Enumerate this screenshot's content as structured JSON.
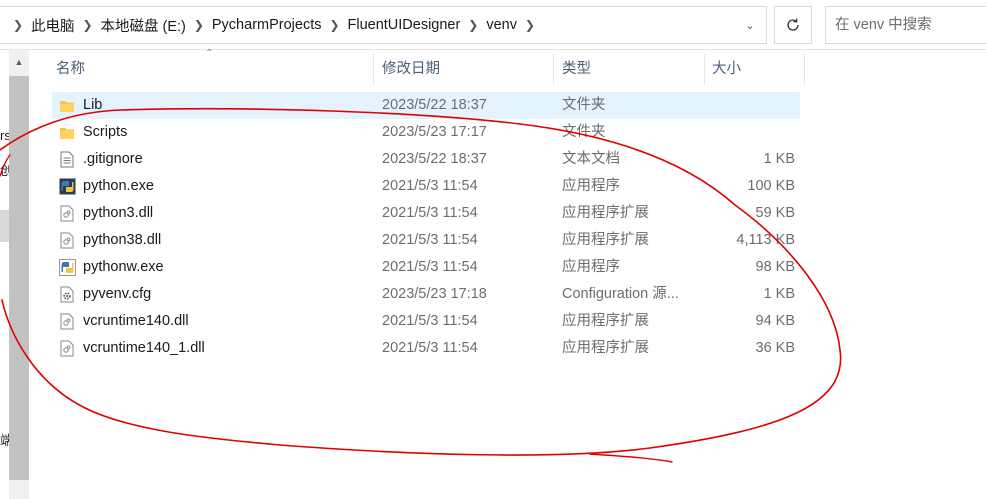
{
  "address_bar": {
    "breadcrumbs": [
      "此电脑",
      "本地磁盘 (E:)",
      "PycharmProjects",
      "FluentUIDesigner",
      "venv"
    ]
  },
  "search": {
    "placeholder": "在 venv 中搜索"
  },
  "nav_fragments": [
    "rs",
    "创",
    "端"
  ],
  "columns": {
    "name": "名称",
    "date": "修改日期",
    "type": "类型",
    "size": "大小"
  },
  "files": [
    {
      "name": "Lib",
      "date": "2023/5/22 18:37",
      "type": "文件夹",
      "size": "",
      "icon": "folder-icon",
      "selected": true
    },
    {
      "name": "Scripts",
      "date": "2023/5/23 17:17",
      "type": "文件夹",
      "size": "",
      "icon": "folder-icon"
    },
    {
      "name": ".gitignore",
      "date": "2023/5/22 18:37",
      "type": "文本文档",
      "size": "1 KB",
      "icon": "text-file-icon"
    },
    {
      "name": "python.exe",
      "date": "2021/5/3 11:54",
      "type": "应用程序",
      "size": "100 KB",
      "icon": "python-exe-icon"
    },
    {
      "name": "python3.dll",
      "date": "2021/5/3 11:54",
      "type": "应用程序扩展",
      "size": "59 KB",
      "icon": "dll-file-icon"
    },
    {
      "name": "python38.dll",
      "date": "2021/5/3 11:54",
      "type": "应用程序扩展",
      "size": "4,113 KB",
      "icon": "dll-file-icon"
    },
    {
      "name": "pythonw.exe",
      "date": "2021/5/3 11:54",
      "type": "应用程序",
      "size": "98 KB",
      "icon": "pythonw-exe-icon"
    },
    {
      "name": "pyvenv.cfg",
      "date": "2023/5/23 17:18",
      "type": "Configuration 源...",
      "size": "1 KB",
      "icon": "config-file-icon"
    },
    {
      "name": "vcruntime140.dll",
      "date": "2021/5/3 11:54",
      "type": "应用程序扩展",
      "size": "94 KB",
      "icon": "dll-file-icon"
    },
    {
      "name": "vcruntime140_1.dll",
      "date": "2021/5/3 11:54",
      "type": "应用程序扩展",
      "size": "36 KB",
      "icon": "dll-file-icon"
    }
  ],
  "colors": {
    "selection": "#e5f3ff",
    "header_text": "#4c607a",
    "annotation": "#e00000",
    "folder": "#f5c04a"
  }
}
